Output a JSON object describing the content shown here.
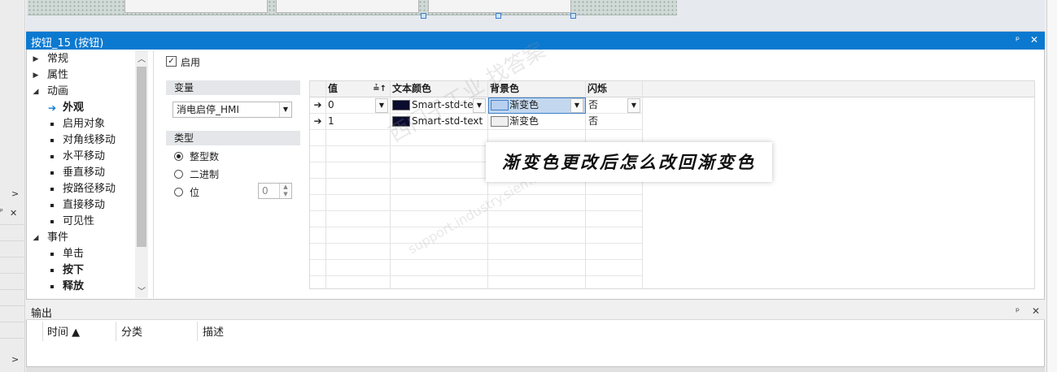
{
  "panel": {
    "title": "按钮_15 (按钮)",
    "pin_icon": "pin-icon",
    "close_icon": "close-icon"
  },
  "tree": {
    "items": [
      {
        "label": "常规",
        "level": 0,
        "expanded": false
      },
      {
        "label": "属性",
        "level": 0,
        "expanded": false
      },
      {
        "label": "动画",
        "level": 0,
        "expanded": true
      },
      {
        "label": "外观",
        "level": 1,
        "selected": true,
        "bold": true
      },
      {
        "label": "启用对象",
        "level": 1
      },
      {
        "label": "对角线移动",
        "level": 1
      },
      {
        "label": "水平移动",
        "level": 1
      },
      {
        "label": "垂直移动",
        "level": 1
      },
      {
        "label": "按路径移动",
        "level": 1
      },
      {
        "label": "直接移动",
        "level": 1
      },
      {
        "label": "可见性",
        "level": 1
      },
      {
        "label": "事件",
        "level": 0,
        "expanded": true
      },
      {
        "label": "单击",
        "level": 1
      },
      {
        "label": "按下",
        "level": 1,
        "bold": true
      },
      {
        "label": "释放",
        "level": 1,
        "bold": true
      }
    ]
  },
  "settings": {
    "enable_label": "启用",
    "enable_checked": true,
    "variable_header": "变量",
    "variable_value": "消电启停_HMI",
    "type_header": "类型",
    "type_options": [
      "整型数",
      "二进制",
      "位"
    ],
    "type_selected": "整型数",
    "bit_value": "0"
  },
  "grid": {
    "headers": [
      "值",
      "文本颜色",
      "背景色",
      "闪烁"
    ],
    "sort_icon": "sort-ascending-icon",
    "rows": [
      {
        "value": "0",
        "text_color": "Smart-std-text",
        "text_color_hex": "#0b0b2e",
        "bg": "渐变色",
        "bg_hex": "#c3d7ee",
        "blink": "否",
        "selected": true
      },
      {
        "value": "1",
        "text_color": "Smart-std-text",
        "text_color_hex": "#0b0b2e",
        "bg": "渐变色",
        "bg_hex": "#efefef",
        "blink": "否",
        "selected": false
      }
    ]
  },
  "overlay": {
    "question": "渐变色更改后怎么改回渐变色"
  },
  "watermark": {
    "line1": "西门子工业 找答案",
    "line2": "support.industry.siemens.com/cs"
  },
  "output": {
    "title": "输出",
    "columns": [
      "时间 ▲",
      "分类",
      "描述"
    ]
  },
  "colors": {
    "accent": "#0b79d0",
    "selection": "#c3d7ee"
  }
}
